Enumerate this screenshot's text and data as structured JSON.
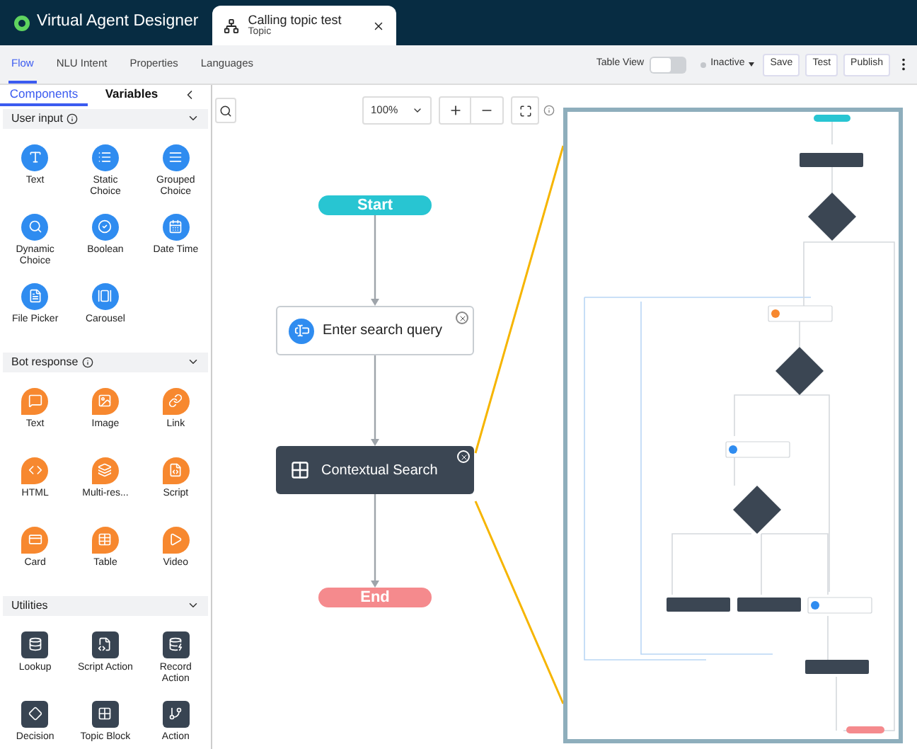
{
  "app": {
    "title": "Virtual Agent Designer"
  },
  "document_tab": {
    "title": "Calling topic test",
    "subtitle": "Topic"
  },
  "nav_tabs": [
    {
      "label": "Flow",
      "selected": true
    },
    {
      "label": "NLU Intent",
      "selected": false
    },
    {
      "label": "Properties",
      "selected": false
    },
    {
      "label": "Languages",
      "selected": false
    }
  ],
  "toolbar": {
    "table_view": {
      "label": "Table View",
      "on": false
    },
    "status": {
      "label": "Inactive"
    },
    "buttons": [
      "Save",
      "Test",
      "Publish"
    ]
  },
  "panel_tabs": [
    {
      "label": "Components",
      "selected": true
    },
    {
      "label": "Variables",
      "selected": false
    }
  ],
  "sections": [
    {
      "kind": "input",
      "title": "User input",
      "info": true,
      "expanded": true,
      "items": [
        "Text",
        "Static Choice",
        "Grouped Choice",
        "Dynamic Choice",
        "Boolean",
        "Date Time",
        "File Picker",
        "Carousel"
      ]
    },
    {
      "kind": "response",
      "title": "Bot response",
      "info": true,
      "expanded": true,
      "items": [
        "Text",
        "Image",
        "Link",
        "HTML",
        "Multi-res...",
        "Script",
        "Card",
        "Table",
        "Video"
      ]
    },
    {
      "kind": "utility",
      "title": "Utilities",
      "info": false,
      "expanded": true,
      "items": [
        "Lookup",
        "Script Action",
        "Record Action",
        "Decision",
        "Topic Block",
        "Action"
      ]
    }
  ],
  "canvas": {
    "zoom": "100%",
    "nodes": [
      {
        "kind": "start",
        "label": "Start"
      },
      {
        "kind": "input",
        "label": "Enter search query"
      },
      {
        "kind": "block",
        "label": "Contextual Search"
      },
      {
        "kind": "end",
        "label": "End"
      }
    ]
  }
}
